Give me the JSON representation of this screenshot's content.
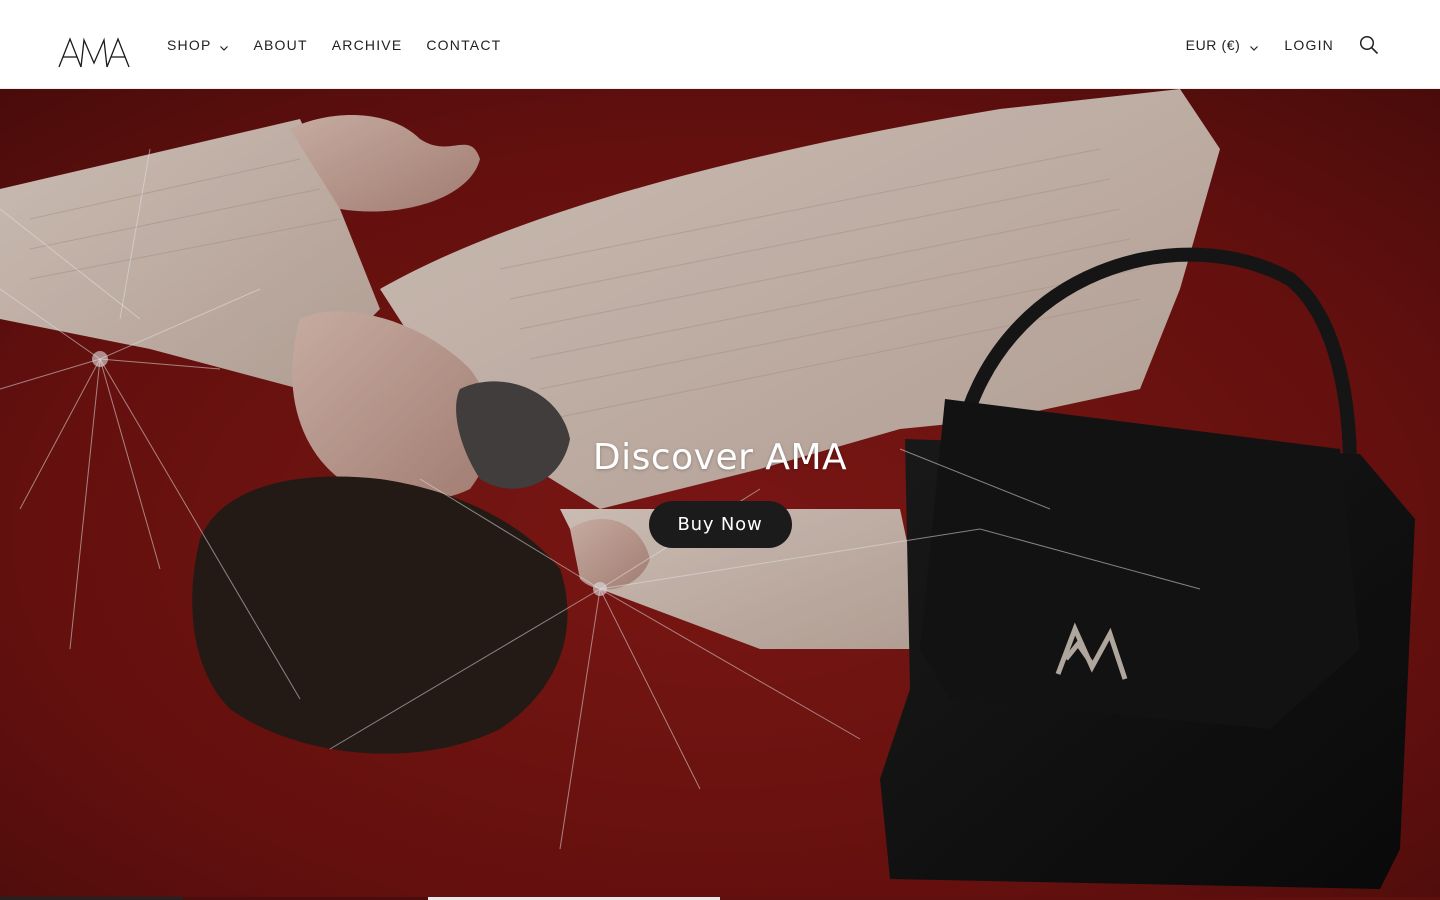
{
  "brand": {
    "logo_text": "AMA"
  },
  "nav": {
    "items": [
      {
        "label": "SHOP",
        "icon": "chevron-down-icon"
      },
      {
        "label": "ABOUT"
      },
      {
        "label": "ARCHIVE"
      },
      {
        "label": "CONTACT"
      }
    ]
  },
  "header_tools": {
    "currency": "EUR (€)",
    "currency_icon": "chevron-down-icon",
    "login": "LOGIN",
    "search_icon": "search-icon"
  },
  "hero": {
    "title": "Discover AMA",
    "button_label": "Buy Now"
  },
  "colors": {
    "background_red": "#7a1614",
    "button_bg": "#1b1b1b",
    "header_text": "#222222"
  }
}
